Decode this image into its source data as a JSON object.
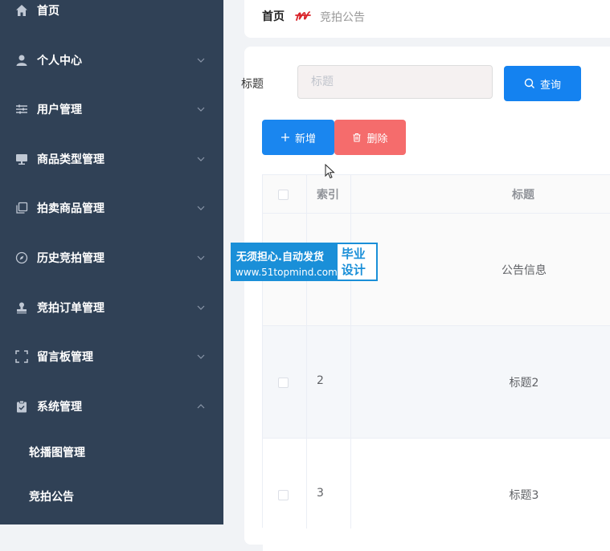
{
  "sidebar": {
    "items": [
      {
        "label": "首页",
        "icon": "home-icon",
        "expanded": null
      },
      {
        "label": "个人中心",
        "icon": "user-icon",
        "expanded": false
      },
      {
        "label": "用户管理",
        "icon": "sliders-icon",
        "expanded": false
      },
      {
        "label": "商品类型管理",
        "icon": "monitor-icon",
        "expanded": false
      },
      {
        "label": "拍卖商品管理",
        "icon": "copy-icon",
        "expanded": false
      },
      {
        "label": "历史竞拍管理",
        "icon": "compass-icon",
        "expanded": false
      },
      {
        "label": "竞拍订单管理",
        "icon": "stamp-icon",
        "expanded": false
      },
      {
        "label": "留言板管理",
        "icon": "fullscreen-icon",
        "expanded": false
      },
      {
        "label": "系统管理",
        "icon": "clipboard-check-icon",
        "expanded": true
      }
    ],
    "subitems": [
      {
        "label": "轮播图管理"
      },
      {
        "label": "竞拍公告"
      }
    ]
  },
  "breadcrumb": {
    "home": "首页",
    "current": "竞拍公告"
  },
  "search": {
    "label": "标题",
    "placeholder": "标题",
    "value": "",
    "button": "查询"
  },
  "actions": {
    "add": "新增",
    "delete": "删除"
  },
  "table": {
    "headers": [
      "索引",
      "标题"
    ],
    "rows": [
      {
        "index": "",
        "title": "公告信息"
      },
      {
        "index": "2",
        "title": "标题2"
      },
      {
        "index": "3",
        "title": "标题3"
      }
    ]
  },
  "watermark": {
    "line1": "无须担心.自动发货",
    "line2": "www.51topmind.com",
    "right_line1": "毕业",
    "right_line2": "设计"
  },
  "colors": {
    "sidebar_bg": "#304156",
    "primary": "#1482f0",
    "danger": "#f56c6c",
    "watermark": "#1a8fd8"
  }
}
